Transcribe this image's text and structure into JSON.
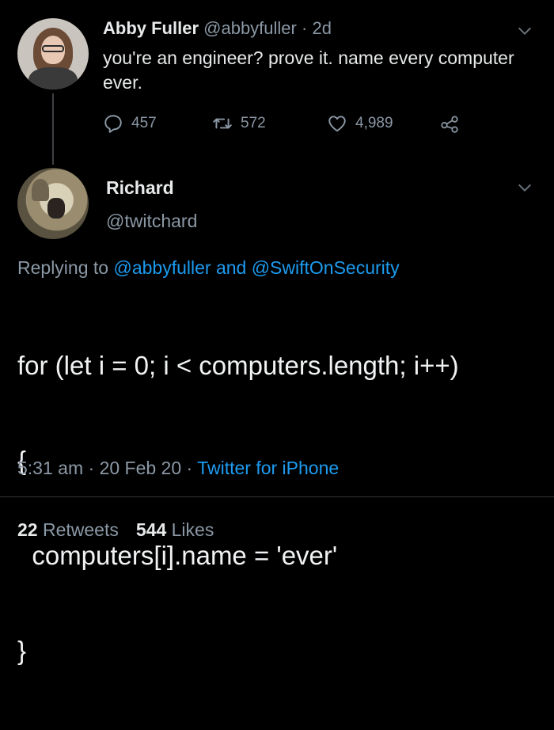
{
  "parent_tweet": {
    "author_name": "Abby Fuller",
    "author_handle": "@abbyfuller",
    "time_separator": "·",
    "age": "2d",
    "text": "you're an engineer? prove it. name every computer ever.",
    "replies": "457",
    "retweets": "572",
    "likes": "4,989",
    "icons": [
      "reply-icon",
      "retweet-icon",
      "like-icon",
      "share-icon",
      "chevron-down-icon"
    ]
  },
  "reply_tweet": {
    "author_name": "Richard",
    "author_handle": "@twitchard",
    "replying_prefix": "Replying to",
    "replying_mention_1": "@abbyfuller",
    "replying_and": "and",
    "replying_mention_2": "@SwiftOnSecurity",
    "code_lines": [
      "for (let i = 0; i < computers.length; i++)",
      "{",
      "  computers[i].name = 'ever'",
      "}"
    ],
    "time": "5:31 am",
    "date": "20 Feb 20",
    "separator": "·",
    "source": "Twitter for iPhone",
    "retweet_count": "22",
    "retweet_label": "Retweets",
    "like_count": "544",
    "like_label": "Likes"
  },
  "colors": {
    "background": "#000000",
    "text_primary": "#e7e9ea",
    "text_secondary": "#8b98a5",
    "link": "#1d9bf0",
    "divider": "#2f3336"
  }
}
